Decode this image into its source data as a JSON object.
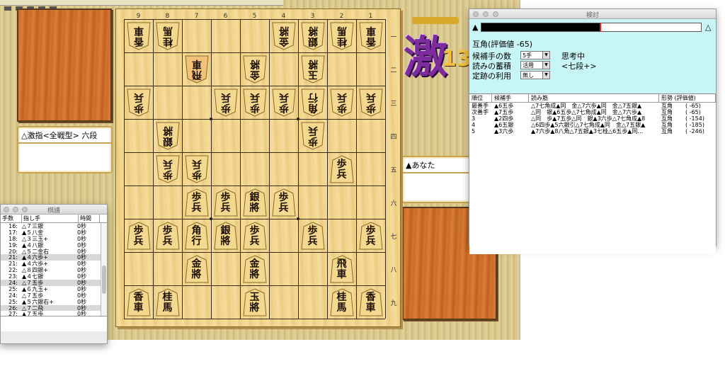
{
  "board": {
    "files": [
      "9",
      "8",
      "7",
      "6",
      "5",
      "4",
      "3",
      "2",
      "1"
    ],
    "ranks": [
      "一",
      "二",
      "三",
      "四",
      "五",
      "六",
      "七",
      "八",
      "九"
    ],
    "pieces": [
      {
        "f": 9,
        "r": 1,
        "o": "g",
        "a": "香",
        "b": "車"
      },
      {
        "f": 8,
        "r": 1,
        "o": "g",
        "a": "桂",
        "b": "馬"
      },
      {
        "f": 4,
        "r": 1,
        "o": "g",
        "a": "金",
        "b": "將"
      },
      {
        "f": 3,
        "r": 1,
        "o": "g",
        "a": "銀",
        "b": "將"
      },
      {
        "f": 2,
        "r": 1,
        "o": "g",
        "a": "桂",
        "b": "馬"
      },
      {
        "f": 1,
        "r": 1,
        "o": "g",
        "a": "香",
        "b": "車"
      },
      {
        "f": 7,
        "r": 2,
        "o": "g",
        "a": "飛",
        "b": "車",
        "hl": true
      },
      {
        "f": 5,
        "r": 2,
        "o": "g",
        "a": "金",
        "b": "將"
      },
      {
        "f": 3,
        "r": 2,
        "o": "g",
        "a": "玉",
        "b": "將"
      },
      {
        "f": 9,
        "r": 3,
        "o": "g",
        "a": "歩",
        "b": "兵"
      },
      {
        "f": 6,
        "r": 3,
        "o": "g",
        "a": "歩",
        "b": "兵"
      },
      {
        "f": 5,
        "r": 3,
        "o": "g",
        "a": "歩",
        "b": "兵"
      },
      {
        "f": 4,
        "r": 3,
        "o": "g",
        "a": "歩",
        "b": "兵"
      },
      {
        "f": 3,
        "r": 3,
        "o": "g",
        "a": "角",
        "b": "行"
      },
      {
        "f": 2,
        "r": 3,
        "o": "g",
        "a": "歩",
        "b": "兵"
      },
      {
        "f": 1,
        "r": 3,
        "o": "g",
        "a": "歩",
        "b": "兵"
      },
      {
        "f": 8,
        "r": 4,
        "o": "g",
        "a": "銀",
        "b": "將"
      },
      {
        "f": 3,
        "r": 4,
        "o": "g",
        "a": "歩",
        "b": "兵"
      },
      {
        "f": 8,
        "r": 5,
        "o": "g",
        "a": "歩",
        "b": "兵"
      },
      {
        "f": 7,
        "r": 5,
        "o": "g",
        "a": "歩",
        "b": "兵"
      },
      {
        "f": 2,
        "r": 5,
        "o": "s",
        "a": "歩",
        "b": "兵"
      },
      {
        "f": 7,
        "r": 6,
        "o": "s",
        "a": "歩",
        "b": "兵"
      },
      {
        "f": 6,
        "r": 6,
        "o": "s",
        "a": "歩",
        "b": "兵"
      },
      {
        "f": 5,
        "r": 6,
        "o": "s",
        "a": "銀",
        "b": "將"
      },
      {
        "f": 4,
        "r": 6,
        "o": "s",
        "a": "歩",
        "b": "兵"
      },
      {
        "f": 9,
        "r": 7,
        "o": "s",
        "a": "歩",
        "b": "兵"
      },
      {
        "f": 8,
        "r": 7,
        "o": "s",
        "a": "歩",
        "b": "兵"
      },
      {
        "f": 7,
        "r": 7,
        "o": "s",
        "a": "角",
        "b": "行"
      },
      {
        "f": 6,
        "r": 7,
        "o": "s",
        "a": "銀",
        "b": "將"
      },
      {
        "f": 5,
        "r": 7,
        "o": "s",
        "a": "歩",
        "b": "兵"
      },
      {
        "f": 3,
        "r": 7,
        "o": "s",
        "a": "歩",
        "b": "兵"
      },
      {
        "f": 1,
        "r": 7,
        "o": "s",
        "a": "歩",
        "b": "兵"
      },
      {
        "f": 7,
        "r": 8,
        "o": "s",
        "a": "金",
        "b": "將"
      },
      {
        "f": 5,
        "r": 8,
        "o": "s",
        "a": "金",
        "b": "將"
      },
      {
        "f": 2,
        "r": 8,
        "o": "s",
        "a": "飛",
        "b": "車"
      },
      {
        "f": 9,
        "r": 9,
        "o": "s",
        "a": "香",
        "b": "車"
      },
      {
        "f": 8,
        "r": 9,
        "o": "s",
        "a": "桂",
        "b": "馬"
      },
      {
        "f": 5,
        "r": 9,
        "o": "s",
        "a": "玉",
        "b": "將"
      },
      {
        "f": 2,
        "r": 9,
        "o": "s",
        "a": "桂",
        "b": "馬"
      },
      {
        "f": 1,
        "r": 9,
        "o": "s",
        "a": "香",
        "b": "車"
      }
    ]
  },
  "players": {
    "gote_name": "△激指<全戦型> 六段",
    "sente_name": "▲あなた"
  },
  "logo": {
    "kanji": "激",
    "number": "13"
  },
  "kifu_window": {
    "title": "棋譜",
    "columns": [
      "手数",
      "指し手",
      "時間"
    ],
    "rows": [
      {
        "n": "16:",
        "m": "△７三銀",
        "t": "0秒"
      },
      {
        "n": "17:",
        "m": "▲５八金",
        "t": "0秒"
      },
      {
        "n": "18:",
        "m": "△３三玉+",
        "t": "0秒"
      },
      {
        "n": "19:",
        "m": "▲４八銀",
        "t": "0秒"
      },
      {
        "n": "20:",
        "m": "△５二金右",
        "t": "0秒"
      },
      {
        "n": "21:",
        "m": "▲４六歩+",
        "t": "0秒"
      },
      {
        "n": "21:",
        "m": "▲４六歩+",
        "t": "0秒"
      },
      {
        "n": "22:",
        "m": "△８四銀+",
        "t": "0秒"
      },
      {
        "n": "23:",
        "m": "▲４七銀",
        "t": "0秒"
      },
      {
        "n": "24:",
        "m": "△７五歩",
        "t": "0秒"
      },
      {
        "n": "25:",
        "m": "▲６九玉+",
        "t": "0秒"
      },
      {
        "n": "24:",
        "m": "△７五歩",
        "t": "0秒"
      },
      {
        "n": "25:",
        "m": "▲５六銀右+",
        "t": "0秒"
      },
      {
        "n": "26:",
        "m": "△７二飛",
        "t": "0秒"
      },
      {
        "n": "27:",
        "m": "▲７五歩",
        "t": "0秒"
      }
    ]
  },
  "analysis_window": {
    "title": "検討",
    "evaluation_label": "互角(評価値 -65)",
    "eval_fraction": 0.54,
    "candidates_label": "候補手の数",
    "candidates_value": "5手",
    "accumulate_label": "読みの蓄積",
    "accumulate_value": "活用",
    "joseki_label": "定跡の利用",
    "joseki_value": "無し",
    "status": "思考中",
    "level": "<七段+>",
    "sente_mark": "▲",
    "gote_mark": "△",
    "columns": [
      "順位",
      "候補手",
      "読み筋",
      "形勢 (評価値)"
    ],
    "rows": [
      {
        "rank": "最善手",
        "move": "▲6五歩",
        "line": "△7七角成▲同　金△7六歩▲同　金△7五銀▲",
        "judge": "互角",
        "value": "( -65)"
      },
      {
        "rank": "次善手",
        "move": "▲7五歩",
        "line": "△同　銀▲6五歩△7七角成▲同　金△7六歩▲",
        "judge": "互角",
        "value": "( -65)"
      },
      {
        "rank": "3",
        "move": "▲2四歩",
        "line": "△同　歩▲7五歩△同　銀▲3六歩△7七角成▲8",
        "judge": "互角",
        "value": "( -154)"
      },
      {
        "rank": "4",
        "move": "▲6五銀",
        "line": "△6四歩▲5六銀引△7七角成▲同　金△7五銀▲",
        "judge": "互角",
        "value": "( -185)"
      },
      {
        "rank": "5",
        "move": "▲3六歩",
        "line": "▲7六歩▲8八角△7五銀▲3七桂△6五歩▲同…",
        "judge": "互角",
        "value": "( -246)"
      }
    ]
  }
}
